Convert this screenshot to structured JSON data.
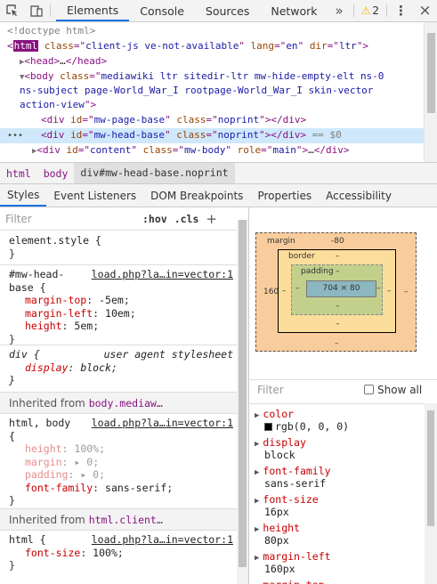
{
  "toolbar": {
    "tabs": [
      "Elements",
      "Console",
      "Sources",
      "Network"
    ],
    "more_label": "»",
    "warning_count": "2",
    "menu_label": "⋮",
    "close_label": "×"
  },
  "dom": {
    "lines": [
      {
        "kind": "doctype",
        "text": "<!doctype html>"
      },
      {
        "kind": "html",
        "tag": "html",
        "attrs": [
          [
            "class",
            "client-js ve-not-available"
          ],
          [
            "lang",
            "en"
          ],
          [
            "dir",
            "ltr"
          ]
        ]
      },
      {
        "kind": "head",
        "tag": "head",
        "collapsed": "…",
        "close": "</head>"
      },
      {
        "kind": "body",
        "text1": "<body class=\"mediawiki ltr sitedir-ltr mw-hide-empty-elt ns-0",
        "text2": "ns-subject page-World_War_I rootpage-World_War_I skin-vector",
        "text3": "action-view\">"
      },
      {
        "kind": "div",
        "id": "mw-page-base",
        "class": "noprint"
      },
      {
        "kind": "div-sel",
        "id": "mw-head-base",
        "class": "noprint",
        "suffix": " == $0"
      },
      {
        "kind": "div-main",
        "id": "content",
        "class": "mw-body",
        "role": "main",
        "collapsed": "…"
      }
    ]
  },
  "breadcrumbs": [
    "html",
    "body",
    "div#mw-head-base.noprint"
  ],
  "subtabs": [
    "Styles",
    "Event Listeners",
    "DOM Breakpoints",
    "Properties",
    "Accessibility"
  ],
  "styles": {
    "filter_placeholder": "Filter",
    "hov": ":hov",
    "cls": ".cls",
    "plus": "+",
    "element_style": "element.style {",
    "rule1": {
      "selector1": "#mw-head-",
      "selector2": "base {",
      "source": "load.php?la…in=vector:1",
      "decls": [
        [
          "margin-top",
          "-5em"
        ],
        [
          "margin-left",
          "10em"
        ],
        [
          "height",
          "5em"
        ]
      ]
    },
    "rule2": {
      "selector": "div {",
      "source": "user agent stylesheet",
      "decls": [
        [
          "display",
          "block"
        ]
      ]
    },
    "inherited1_label": "Inherited from",
    "inherited1_el": "body.mediaw…",
    "rule3": {
      "selector1": "html, body",
      "selector2": "{",
      "source": "load.php?la…in=vector:1",
      "decls": [
        [
          "height",
          "100%"
        ],
        [
          "margin",
          "0"
        ],
        [
          "padding",
          "0"
        ],
        [
          "font-family",
          "sans-serif"
        ]
      ]
    },
    "inherited2_label": "Inherited from",
    "inherited2_el": "html.client…",
    "rule4": {
      "selector": "html {",
      "source": "load.php?la…in=vector:1",
      "decls": [
        [
          "font-size",
          "100%"
        ]
      ]
    },
    "close_brace": "}"
  },
  "box_model": {
    "margin_label": "margin",
    "margin_top": "-80",
    "margin_left": "160",
    "margin_right": "–",
    "margin_bottom": "–",
    "border_label": "border",
    "border_top": "–",
    "border_left": "–",
    "border_right": "–",
    "border_bottom": "–",
    "padding_label": "padding",
    "padding_top": "–",
    "padding_left": "–",
    "padding_right": "–",
    "padding_bottom": "–",
    "content_size": "704 × 80"
  },
  "computed": {
    "filter_placeholder": "Filter",
    "show_all": "Show all",
    "props": [
      {
        "name": "color",
        "value": "rgb(0, 0, 0)",
        "swatch": "#000000"
      },
      {
        "name": "display",
        "value": "block"
      },
      {
        "name": "font-family",
        "value": "sans-serif"
      },
      {
        "name": "font-size",
        "value": "16px"
      },
      {
        "name": "height",
        "value": "80px"
      },
      {
        "name": "margin-left",
        "value": "160px"
      },
      {
        "name": "margin-top",
        "value": ""
      }
    ]
  }
}
